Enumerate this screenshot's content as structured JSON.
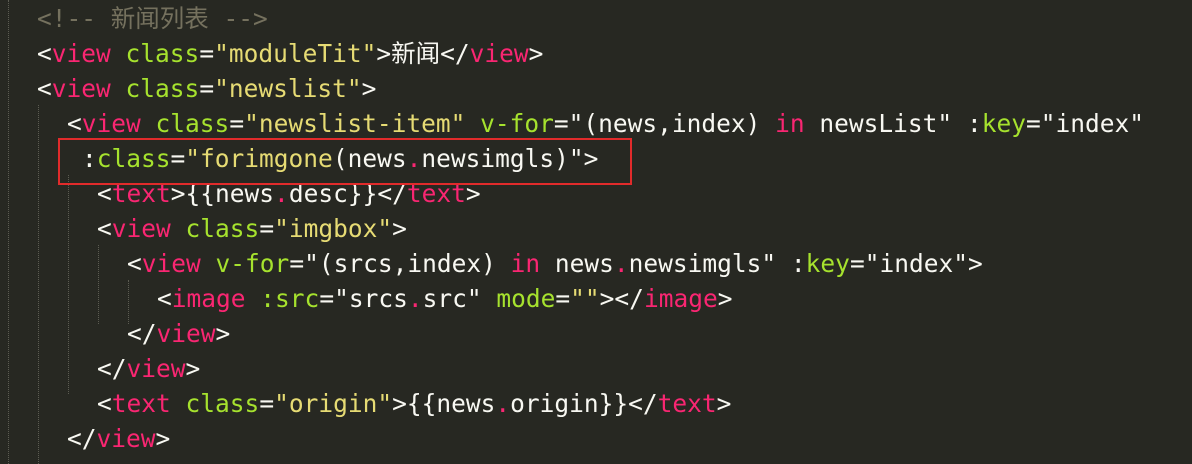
{
  "editor": {
    "lines": [
      {
        "indent": 0,
        "tokens": [
          {
            "text": "<!-- 新闻列表 -->",
            "kind": "comment"
          }
        ]
      },
      {
        "indent": 0,
        "tokens": [
          {
            "text": "<",
            "kind": "plain"
          },
          {
            "text": "view",
            "kind": "tag"
          },
          {
            "text": " ",
            "kind": "plain"
          },
          {
            "text": "class",
            "kind": "attr"
          },
          {
            "text": "=",
            "kind": "plain"
          },
          {
            "text": "\"moduleTit\"",
            "kind": "str"
          },
          {
            "text": ">新闻</",
            "kind": "plain"
          },
          {
            "text": "view",
            "kind": "tag"
          },
          {
            "text": ">",
            "kind": "plain"
          }
        ]
      },
      {
        "indent": 0,
        "tokens": [
          {
            "text": "<",
            "kind": "plain"
          },
          {
            "text": "view",
            "kind": "tag"
          },
          {
            "text": " ",
            "kind": "plain"
          },
          {
            "text": "class",
            "kind": "attr"
          },
          {
            "text": "=",
            "kind": "plain"
          },
          {
            "text": "\"newslist\"",
            "kind": "str"
          },
          {
            "text": ">",
            "kind": "plain"
          }
        ]
      },
      {
        "indent": 1,
        "tokens": [
          {
            "text": "<",
            "kind": "plain"
          },
          {
            "text": "view",
            "kind": "tag"
          },
          {
            "text": " ",
            "kind": "plain"
          },
          {
            "text": "class",
            "kind": "attr"
          },
          {
            "text": "=",
            "kind": "plain"
          },
          {
            "text": "\"newslist-item\"",
            "kind": "str"
          },
          {
            "text": " ",
            "kind": "plain"
          },
          {
            "text": "v-for",
            "kind": "attr"
          },
          {
            "text": "=",
            "kind": "plain"
          },
          {
            "text": "\"(news,index) ",
            "kind": "plain"
          },
          {
            "text": "in",
            "kind": "kw"
          },
          {
            "text": " newsList\" ",
            "kind": "plain"
          },
          {
            "text": ":",
            "kind": "plain"
          },
          {
            "text": "key",
            "kind": "attr"
          },
          {
            "text": "=",
            "kind": "plain"
          },
          {
            "text": "\"index\"",
            "kind": "plain"
          }
        ]
      },
      {
        "indent": 1.5,
        "tokens": [
          {
            "text": ":",
            "kind": "plain"
          },
          {
            "text": "class",
            "kind": "attr"
          },
          {
            "text": "=",
            "kind": "plain"
          },
          {
            "text": "\"forimgone",
            "kind": "str"
          },
          {
            "text": "(news",
            "kind": "plain"
          },
          {
            "text": ".",
            "kind": "tag"
          },
          {
            "text": "newsimgls)\">",
            "kind": "plain"
          }
        ]
      },
      {
        "indent": 2,
        "tokens": [
          {
            "text": "<",
            "kind": "plain"
          },
          {
            "text": "text",
            "kind": "tag"
          },
          {
            "text": ">{{news",
            "kind": "plain"
          },
          {
            "text": ".",
            "kind": "tag"
          },
          {
            "text": "desc}}</",
            "kind": "plain"
          },
          {
            "text": "text",
            "kind": "tag"
          },
          {
            "text": ">",
            "kind": "plain"
          }
        ]
      },
      {
        "indent": 2,
        "tokens": [
          {
            "text": "<",
            "kind": "plain"
          },
          {
            "text": "view",
            "kind": "tag"
          },
          {
            "text": " ",
            "kind": "plain"
          },
          {
            "text": "class",
            "kind": "attr"
          },
          {
            "text": "=",
            "kind": "plain"
          },
          {
            "text": "\"imgbox\"",
            "kind": "str"
          },
          {
            "text": ">",
            "kind": "plain"
          }
        ]
      },
      {
        "indent": 3,
        "tokens": [
          {
            "text": "<",
            "kind": "plain"
          },
          {
            "text": "view",
            "kind": "tag"
          },
          {
            "text": " ",
            "kind": "plain"
          },
          {
            "text": "v-for",
            "kind": "attr"
          },
          {
            "text": "=",
            "kind": "plain"
          },
          {
            "text": "\"(srcs,index) ",
            "kind": "plain"
          },
          {
            "text": "in",
            "kind": "kw"
          },
          {
            "text": " news",
            "kind": "plain"
          },
          {
            "text": ".",
            "kind": "tag"
          },
          {
            "text": "newsimgls\" ",
            "kind": "plain"
          },
          {
            "text": ":",
            "kind": "plain"
          },
          {
            "text": "key",
            "kind": "attr"
          },
          {
            "text": "=",
            "kind": "plain"
          },
          {
            "text": "\"index\"",
            "kind": "plain"
          },
          {
            "text": ">",
            "kind": "plain"
          }
        ]
      },
      {
        "indent": 4,
        "tokens": [
          {
            "text": "<",
            "kind": "plain"
          },
          {
            "text": "image",
            "kind": "tag"
          },
          {
            "text": " ",
            "kind": "plain"
          },
          {
            "text": ":src",
            "kind": "attr"
          },
          {
            "text": "=",
            "kind": "plain"
          },
          {
            "text": "\"srcs",
            "kind": "plain"
          },
          {
            "text": ".",
            "kind": "tag"
          },
          {
            "text": "src\" ",
            "kind": "plain"
          },
          {
            "text": "mode",
            "kind": "attr"
          },
          {
            "text": "=",
            "kind": "plain"
          },
          {
            "text": "\"\"",
            "kind": "str"
          },
          {
            "text": "></",
            "kind": "plain"
          },
          {
            "text": "image",
            "kind": "tag"
          },
          {
            "text": ">",
            "kind": "plain"
          }
        ]
      },
      {
        "indent": 3,
        "tokens": [
          {
            "text": "</",
            "kind": "plain"
          },
          {
            "text": "view",
            "kind": "tag"
          },
          {
            "text": ">",
            "kind": "plain"
          }
        ]
      },
      {
        "indent": 2,
        "tokens": [
          {
            "text": "</",
            "kind": "plain"
          },
          {
            "text": "view",
            "kind": "tag"
          },
          {
            "text": ">",
            "kind": "plain"
          }
        ]
      },
      {
        "indent": 2,
        "tokens": [
          {
            "text": "<",
            "kind": "plain"
          },
          {
            "text": "text",
            "kind": "tag"
          },
          {
            "text": " ",
            "kind": "plain"
          },
          {
            "text": "class",
            "kind": "attr"
          },
          {
            "text": "=",
            "kind": "plain"
          },
          {
            "text": "\"origin\"",
            "kind": "str"
          },
          {
            "text": ">{{news",
            "kind": "plain"
          },
          {
            "text": ".",
            "kind": "tag"
          },
          {
            "text": "origin}}</",
            "kind": "plain"
          },
          {
            "text": "text",
            "kind": "tag"
          },
          {
            "text": ">",
            "kind": "plain"
          }
        ]
      },
      {
        "indent": 1,
        "tokens": [
          {
            "text": "</",
            "kind": "plain"
          },
          {
            "text": "view",
            "kind": "tag"
          },
          {
            "text": ">",
            "kind": "plain"
          }
        ]
      }
    ],
    "colors": {
      "background": "#272822",
      "plain": "#f8f8f2",
      "tag": "#f92672",
      "attr": "#a6e22e",
      "string": "#e6db74",
      "comment": "#75715e",
      "highlight_box": "#e12b2b"
    }
  }
}
